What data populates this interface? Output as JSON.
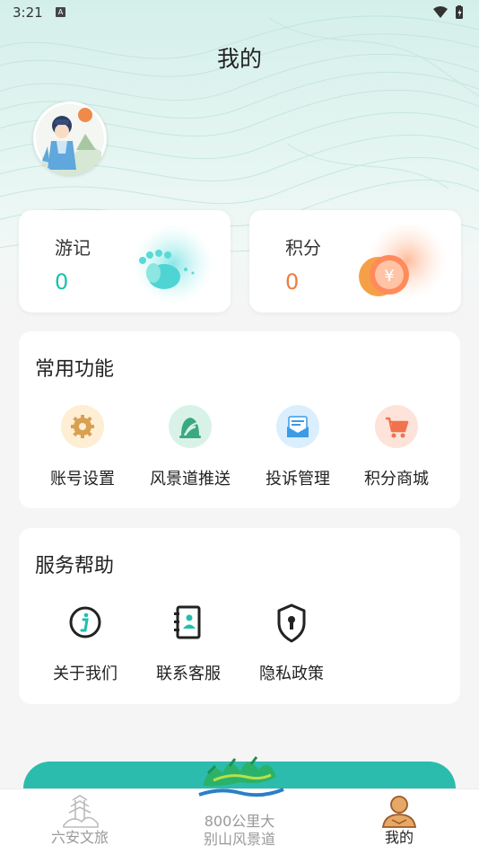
{
  "status_bar": {
    "time": "3:21",
    "notification_badge": "A"
  },
  "header": {
    "title": "我的"
  },
  "stats": [
    {
      "label": "游记",
      "value": "0",
      "value_color": "#1fbfae"
    },
    {
      "label": "积分",
      "value": "0",
      "value_color": "#f07c3e"
    }
  ],
  "common_functions": {
    "title": "常用功能",
    "items": [
      {
        "label": "账号设置",
        "icon": "gear-icon",
        "bg": "#fdeed4",
        "color": "#d9a052"
      },
      {
        "label": "风景道推送",
        "icon": "scenic-road-icon",
        "bg": "#d9f2e8",
        "color": "#3aa982"
      },
      {
        "label": "投诉管理",
        "icon": "mail-icon",
        "bg": "#dbeefd",
        "color": "#3a9be6"
      },
      {
        "label": "积分商城",
        "icon": "cart-icon",
        "bg": "#fde3d9",
        "color": "#f0734d"
      }
    ]
  },
  "service_help": {
    "title": "服务帮助",
    "items": [
      {
        "label": "关于我们",
        "icon": "info-icon"
      },
      {
        "label": "联系客服",
        "icon": "contacts-icon"
      },
      {
        "label": "隐私政策",
        "icon": "privacy-shield-icon"
      }
    ]
  },
  "tabbar": {
    "tabs": [
      {
        "label": "六安文旅",
        "icon": "pagoda-icon",
        "active": false
      },
      {
        "label": "800公里大别山风景道",
        "line1": "800公里大",
        "line2": "别山风景道",
        "icon": "scenic-logo-icon",
        "active": false
      },
      {
        "label": "我的",
        "icon": "user-icon",
        "active": true
      }
    ],
    "active_color": "#222222",
    "inactive_color": "#999999"
  }
}
